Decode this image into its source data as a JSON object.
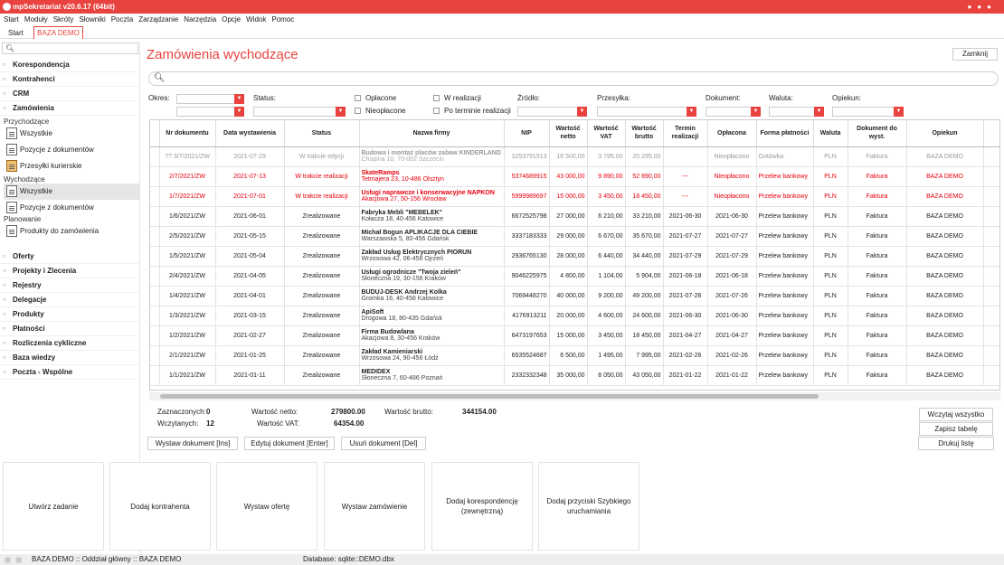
{
  "window": {
    "title": "mpSekretariat v20.6.17 (64bit)"
  },
  "menu": [
    "Start",
    "Moduły",
    "Skróty",
    "Słowniki",
    "Poczta",
    "Zarządzanie",
    "Narzędzia",
    "Opcje",
    "Widok",
    "Pomoc"
  ],
  "tabs": [
    {
      "label": "Start"
    },
    {
      "label": "BAZA DEMO"
    }
  ],
  "sidebar": {
    "sections_top": [
      "Korespondencja",
      "Kontrahenci",
      "CRM",
      "Zamówienia"
    ],
    "przychodzace_label": "Przychodzące",
    "przychodzace": [
      "Wszystkie",
      "Pozycje z dokumentów",
      "Przesyłki kurierskie"
    ],
    "wychodzace_label": "Wychodzące",
    "wychodzace": [
      "Wszystkie",
      "Pozycje z dokumentów"
    ],
    "planowanie_label": "Planowanie",
    "planowanie": [
      "Produkty do zamówienia"
    ],
    "sections_bottom": [
      "Oferty",
      "Projekty i Zlecenia",
      "Rejestry",
      "Delegacje",
      "Produkty",
      "Płatności",
      "Rozliczenia cykliczne",
      "Baza wiedzy",
      "Poczta - Wspólne"
    ]
  },
  "main": {
    "title": "Zamówienia wychodzące",
    "close_label": "Zamknij"
  },
  "filters": {
    "okres": "Okres:",
    "status": "Status:",
    "oplacone": "Opłacone",
    "nieoplacone": "Nieopłacone",
    "w_realizacji": "W realizacji",
    "po_terminie": "Po terminie realizacji",
    "zrodlo": "Źródło:",
    "przesylka": "Przesyłka:",
    "dokument": "Dokument:",
    "waluta": "Waluta:",
    "opiekun": "Opiekun:"
  },
  "table": {
    "headers": [
      "Nr dokumentu",
      "Data wystawienia",
      "Status",
      "Nazwa firmy",
      "NIP",
      "Wartość netto",
      "Wartość VAT",
      "Wartość brutto",
      "Termin realizacji",
      "Opłacona",
      "Forma płatności",
      "Waluta",
      "Dokument do wyst.",
      "Opiekun"
    ],
    "rows": [
      {
        "style": "gray",
        "nr": "?? 3/7/2021/ZW",
        "date": "2021-07-29",
        "status": "W trakcie edycji",
        "name": "Budowa i montaż placów zabaw KINDERLAND",
        "addr": "Chopina 10, 70-002 Szczecin",
        "nip": "3253791513",
        "netto": "16 500,00",
        "vat": "3 795,00",
        "brutto": "20 295,00",
        "termin": "",
        "oplacona": "Nieopłacono",
        "forma": "Gotówka",
        "waluta": "PLN",
        "dok": "Faktura",
        "opiekun": "BAZA DEMO"
      },
      {
        "style": "red",
        "nr": "2/7/2021/ZW",
        "date": "2021-07-13",
        "status": "W trakcie realizacji",
        "name": "SkateRamps",
        "addr": "Tetmajera 23, 10-486 Olsztyn",
        "nip": "5374689915",
        "netto": "43 000,00",
        "vat": "9 890,00",
        "brutto": "52 890,00",
        "termin": "---",
        "oplacona": "Nieopłacono",
        "forma": "Przelew bankowy",
        "waluta": "PLN",
        "dok": "Faktura",
        "opiekun": "BAZA DEMO"
      },
      {
        "style": "red",
        "nr": "1/7/2021/ZW",
        "date": "2021-07-01",
        "status": "W trakcie realizacji",
        "name": "Usługi naprawcze i konserwacyjne NAPKON",
        "addr": "Akacjowa 27, 50-156 Wrocław",
        "nip": "5999989697",
        "netto": "15 000,00",
        "vat": "3 450,00",
        "brutto": "18 450,00",
        "termin": "---",
        "oplacona": "Nieopłacono",
        "forma": "Przelew bankowy",
        "waluta": "PLN",
        "dok": "Faktura",
        "opiekun": "BAZA DEMO"
      },
      {
        "style": "",
        "nr": "1/6/2021/ZW",
        "date": "2021-06-01",
        "status": "Zrealizowane",
        "name": "Fabryka Mebli \"MEBELEK\"",
        "addr": "Kołacza 18, 40-456 Katowice",
        "nip": "6672525798",
        "netto": "27 000,00",
        "vat": "6 210,00",
        "brutto": "33 210,00",
        "termin": "2021-06-30",
        "oplacona": "2021-06-30",
        "forma": "Przelew bankowy",
        "waluta": "PLN",
        "dok": "Faktura",
        "opiekun": "BAZA DEMO"
      },
      {
        "style": "",
        "nr": "2/5/2021/ZW",
        "date": "2021-05-15",
        "status": "Zrealizowane",
        "name": "Michał Bogun APLIKACJE DLA CIEBIE",
        "addr": "Warszawska 5, 80-456 Gdańsk",
        "nip": "3337183333",
        "netto": "29 000,00",
        "vat": "6 670,00",
        "brutto": "35 670,00",
        "termin": "2021-07-27",
        "oplacona": "2021-07-27",
        "forma": "Przelew bankowy",
        "waluta": "PLN",
        "dok": "Faktura",
        "opiekun": "BAZA DEMO"
      },
      {
        "style": "",
        "nr": "1/5/2021/ZW",
        "date": "2021-05-04",
        "status": "Zrealizowane",
        "name": "Zakład Usług Elektrycznych PIORUN",
        "addr": "Wrzosowa 42, 06-456 Ojrzeń",
        "nip": "2936765130",
        "netto": "28 000,00",
        "vat": "6 440,00",
        "brutto": "34 440,00",
        "termin": "2021-07-29",
        "oplacona": "2021-07-29",
        "forma": "Przelew bankowy",
        "waluta": "PLN",
        "dok": "Faktura",
        "opiekun": "BAZA DEMO"
      },
      {
        "style": "",
        "nr": "2/4/2021/ZW",
        "date": "2021-04-05",
        "status": "Zrealizowane",
        "name": "Usługi ogrodnicze \"Twoja zieleń\"",
        "addr": "Słoneczna 19, 30-156 Kraków",
        "nip": "9046225975",
        "netto": "4 800,00",
        "vat": "1 104,00",
        "brutto": "5 904,00",
        "termin": "2021-06-18",
        "oplacona": "2021-06-18",
        "forma": "Przelew bankowy",
        "waluta": "PLN",
        "dok": "Faktura",
        "opiekun": "BAZA DEMO"
      },
      {
        "style": "",
        "nr": "1/4/2021/ZW",
        "date": "2021-04-01",
        "status": "Zrealizowane",
        "name": "BUDUJ-DESK Andrzej Kolka",
        "addr": "Gromka 16, 40-458 Katowice",
        "nip": "7069448270",
        "netto": "40 000,00",
        "vat": "9 200,00",
        "brutto": "49 200,00",
        "termin": "2021-07-26",
        "oplacona": "2021-07-26",
        "forma": "Przelew bankowy",
        "waluta": "PLN",
        "dok": "Faktura",
        "opiekun": "BAZA DEMO"
      },
      {
        "style": "",
        "nr": "1/3/2021/ZW",
        "date": "2021-03-15",
        "status": "Zrealizowane",
        "name": "ApiSoft",
        "addr": "Drogowa 18, 80-435 Gdańsk",
        "nip": "4176913211",
        "netto": "20 000,00",
        "vat": "4 600,00",
        "brutto": "24 600,00",
        "termin": "2021-06-30",
        "oplacona": "2021-06-30",
        "forma": "Przelew bankowy",
        "waluta": "PLN",
        "dok": "Faktura",
        "opiekun": "BAZA DEMO"
      },
      {
        "style": "",
        "nr": "1/2/2021/ZW",
        "date": "2021-02-27",
        "status": "Zrealizowane",
        "name": "Firma Budowlana",
        "addr": "Akacjowa 8, 30-456 Kraków",
        "nip": "6473197653",
        "netto": "15 000,00",
        "vat": "3 450,00",
        "brutto": "18 450,00",
        "termin": "2021-04-27",
        "oplacona": "2021-04-27",
        "forma": "Przelew bankowy",
        "waluta": "PLN",
        "dok": "Faktura",
        "opiekun": "BAZA DEMO"
      },
      {
        "style": "",
        "nr": "2/1/2021/ZW",
        "date": "2021-01-25",
        "status": "Zrealizowane",
        "name": "Zakład Kamieniarski",
        "addr": "Wrzosowa 24, 90-456 Łódź",
        "nip": "6535524687",
        "netto": "6 500,00",
        "vat": "1 495,00",
        "brutto": "7 995,00",
        "termin": "2021-02-26",
        "oplacona": "2021-02-26",
        "forma": "Przelew bankowy",
        "waluta": "PLN",
        "dok": "Faktura",
        "opiekun": "BAZA DEMO"
      },
      {
        "style": "",
        "nr": "1/1/2021/ZW",
        "date": "2021-01-11",
        "status": "Zrealizowane",
        "name": "MEDIDEX",
        "addr": "Słoneczna 7, 60-486 Poznań",
        "nip": "2332332348",
        "netto": "35 000,00",
        "vat": "8 050,00",
        "brutto": "43 050,00",
        "termin": "2021-01-22",
        "oplacona": "2021-01-22",
        "forma": "Przelew bankowy",
        "waluta": "PLN",
        "dok": "Faktura",
        "opiekun": "BAZA DEMO"
      }
    ]
  },
  "summary": {
    "zaznaczonych_label": "Zaznaczonych:",
    "zaznaczonych": "0",
    "wczytanych_label": "Wczytanych:",
    "wczytanych": "12",
    "netto_label": "Wartość netto:",
    "netto": "279800.00",
    "vat_label": "Wartość VAT:",
    "vat": "64354.00",
    "brutto_label": "Wartość brutto:",
    "brutto": "344154.00"
  },
  "buttons": {
    "wczytaj": "Wczytaj wszystko",
    "zapisz": "Zapisz tabelę",
    "drukuj": "Drukuj listę",
    "wystaw": "Wystaw dokument [Ins]",
    "edytuj": "Edytuj dokument [Enter]",
    "usun": "Usuń dokument [Del]"
  },
  "tiles": [
    "Utwórz zadanie",
    "Dodaj kontrahenta",
    "Wystaw ofertę",
    "Wystaw zamówienie",
    "Dodaj korespondencję (zewnętrzną)",
    "Dodaj przyciski Szybkiego uruchamiania"
  ],
  "status": {
    "left": "BAZA DEMO :: Oddział główny :: BAZA DEMO",
    "db": "Database: sqlite::DEMO.dbx"
  },
  "colors": {
    "accent": "#e8433e",
    "red_text": "#e8000d"
  }
}
